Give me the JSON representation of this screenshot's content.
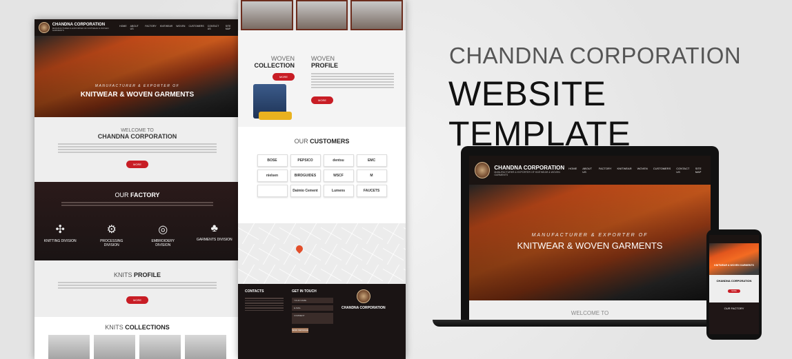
{
  "headline": {
    "line1": "CHANDNA CORPORATION",
    "line2": "WEBSITE TEMPLATE"
  },
  "brand": {
    "name": "CHANDNA CORPORATION",
    "sub": "MANUFACTURER & EXPORTER OF KNITWEAR & WOVEN GARMENTS"
  },
  "nav": [
    "HOME",
    "ABOUT US",
    "FACTORY",
    "KNITWEAR",
    "WOVEN",
    "CUSTOMERS",
    "CONTACT US",
    "SITE MAP"
  ],
  "hero": {
    "tagline": "MANUFACTURER & EXPORTER OF",
    "title": "KNITWEAR & WOVEN GARMENTS"
  },
  "welcome": {
    "small": "WELCOME TO",
    "big": "CHANDNA CORPORATION",
    "more": "MORE"
  },
  "factory": {
    "title_a": "OUR ",
    "title_b": "FACTORY",
    "divisions": [
      {
        "icon": "yarn-icon",
        "glyph": "✣",
        "label": "KNITTING DIVISION"
      },
      {
        "icon": "machine-icon",
        "glyph": "⚙",
        "label": "PROCESSING DIVISION"
      },
      {
        "icon": "hoop-icon",
        "glyph": "◎",
        "label": "EMBROIDERY DIVISION"
      },
      {
        "icon": "shirt-icon",
        "glyph": "♣",
        "label": "GARMENTS DIVISION"
      }
    ]
  },
  "knits_profile": {
    "a": "KNITS ",
    "b": "PROFILE",
    "more": "MORE"
  },
  "knits_collections": {
    "a": "KNITS ",
    "b": "COLLECTIONS"
  },
  "woven_collection": {
    "a": "WOVEN",
    "b": "COLLECTION",
    "more": "MORE"
  },
  "woven_profile": {
    "a": "WOVEN",
    "b": "PROFILE",
    "more": "MORE"
  },
  "customers": {
    "a": "OUR ",
    "b": "CUSTOMERS",
    "logos": [
      "BOSE",
      "PEPSICO",
      "dentsu",
      "EMC",
      "nielsen",
      "BIRDGUIDES",
      "WSCF",
      "M",
      "",
      "Daimio Cement",
      "Lumens",
      "FAUCETS"
    ]
  },
  "footer": {
    "contacts": "CONTACTS",
    "get_in_touch": "GET IN TOUCH",
    "name": "YOUR NAME",
    "email": "E-MAIL",
    "comment": "COMMENT",
    "send": "SEND MESSAGE",
    "brand": "CHANDNA CORPORATION"
  },
  "laptop_welcome": "WELCOME TO",
  "phone": {
    "brand": "CHANDNA CORPORATION",
    "factory": "OUR FACTORY",
    "more": "MORE"
  }
}
